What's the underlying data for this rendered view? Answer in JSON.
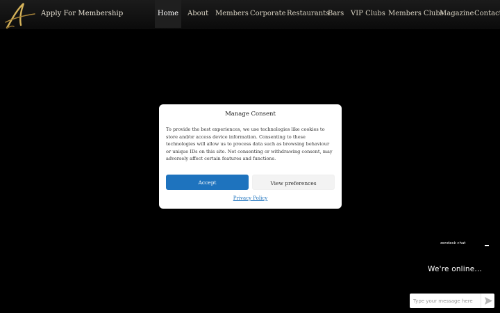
{
  "header": {
    "logo_icon": "script-a-logo-icon",
    "apply_label": "Apply For Membership",
    "nav": [
      {
        "label": "Home",
        "active": true
      },
      {
        "label": "About"
      },
      {
        "label": "Members"
      },
      {
        "label": "Corporate"
      },
      {
        "label": "Restaurants"
      },
      {
        "label": "Bars"
      },
      {
        "label": "VIP Clubs"
      },
      {
        "label": "Members Clubs"
      },
      {
        "label": "Magazine"
      },
      {
        "label": "Contact"
      }
    ]
  },
  "consent": {
    "title": "Manage Consent",
    "body": "To provide the best experiences, we use technologies like cookies to store and/or access device information. Consenting to these technologies will allow us to process data such as browsing behaviour or unique IDs on this site. Not consenting or withdrawing consent, may adversely affect certain features and functions.",
    "accept_label": "Accept",
    "preferences_label": "View preferences",
    "privacy_label": "Privacy Policy"
  },
  "chat": {
    "brand": "zendesk chat",
    "status": "We're online...",
    "input_placeholder": "Type your message here",
    "send_icon": "send-arrow-icon"
  },
  "colors": {
    "accent": "#1e73be",
    "background": "#000000",
    "logo_gold": "#c9a24a"
  }
}
